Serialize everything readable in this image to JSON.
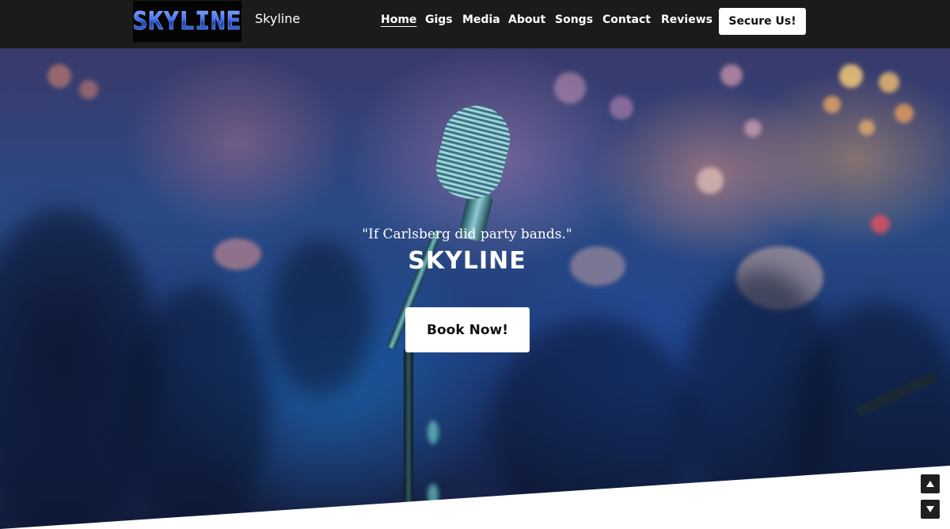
{
  "header": {
    "logo_text": "SKYLINE",
    "brand_name": "Skyline",
    "nav": [
      {
        "label": "Home",
        "active": true
      },
      {
        "label": "Gigs"
      },
      {
        "label": "Media"
      },
      {
        "label": "About"
      },
      {
        "label": "Songs"
      },
      {
        "label": "Contact"
      },
      {
        "label": "Reviews"
      }
    ],
    "cta_label": "Secure Us!"
  },
  "hero": {
    "quote": "\"If Carlsberg did party bands.\"",
    "title": "SKYLINE",
    "button_label": "Book Now!"
  },
  "scroll": {
    "up_icon": "triangle-up-icon",
    "down_icon": "triangle-down-icon"
  },
  "colors": {
    "header_bg": "#1b1b1b",
    "button_bg": "#ffffff",
    "text_light": "#ffffff",
    "logo_blue": "#3a6cf0"
  }
}
